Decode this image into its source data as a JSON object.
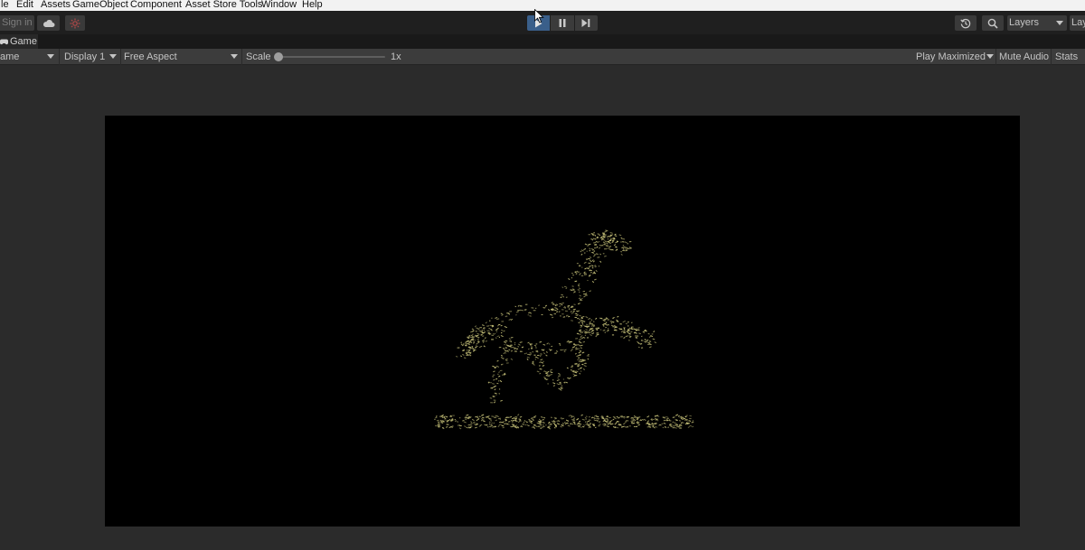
{
  "menu": {
    "items": [
      "le",
      "Edit",
      "Assets",
      "GameObject",
      "Component",
      "Asset Store Tools",
      "Window",
      "Help"
    ]
  },
  "toolbar": {
    "sign_in": "Sign in",
    "cloud_icon": "cloud-icon",
    "collab_icon": "collab-icon",
    "play_icon": "play-icon",
    "pause_icon": "pause-icon",
    "step_icon": "step-icon",
    "history_icon": "history-icon",
    "search_icon": "search-icon",
    "layers": "Layers",
    "layout": "Lay"
  },
  "tab": {
    "icon": "game-controller-icon",
    "label": "Game"
  },
  "game_toolbar": {
    "mode": "ame",
    "display": "Display 1",
    "aspect": "Free Aspect",
    "scale_label": "Scale",
    "scale_value": "1x",
    "scale_level": 0.0,
    "play_mode": "Play Maximized",
    "mute_audio": "Mute Audio",
    "stats": "Stats"
  },
  "scene": {
    "subject": "particle-horse",
    "particle_color": "#c8c37a",
    "background_color": "#000000"
  },
  "colors": {
    "play_active": "#3a5f8a",
    "toolbar_bg": "#1f1f1f",
    "panel_bg": "#3c3c3c"
  }
}
